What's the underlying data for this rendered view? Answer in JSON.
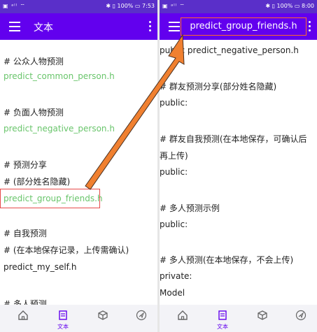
{
  "left": {
    "status_left": "▣ ᵃˡˡ ⌔",
    "status_right": "✱ ▯ 100% ▭ 7:53",
    "title": "文本",
    "lines": [
      "# 公众人物预测",
      "predict_common_person.h",
      "# 负面人物预测",
      "predict_negative_person.h",
      "# 预测分享",
      "#  (部分姓名隐藏)",
      "predict_group_friends.h",
      "# 自我预测",
      "#  (在本地保存记录，上传需确认)",
      "predict_my_self.h",
      "# 多人预测"
    ],
    "nav_label": "文本"
  },
  "right": {
    "status_left": "▣ ᵃˡˡ ⌔",
    "status_right": "✱ ▯ 100% ▭ 8:00",
    "title": "predict_group_friends.h",
    "lines": [
      "public predict_negative_person.h",
      "# 群友预测分享(部分姓名隐藏)",
      "public:",
      "# 群友自我预测(在本地保存，可确认后",
      "再上传)",
      "public:",
      "# 多人预测示例",
      "public:",
      "# 多人预测(在本地保存，不会上传)",
      "private:",
      "Model"
    ],
    "nav_label": "文本"
  },
  "colors": {
    "appbar": "#6200ee",
    "statusbar": "#5a2fc9",
    "code": "#69c56b",
    "arrow": "#f08030",
    "highlight": "#e64a4a",
    "title_highlight": "#ff6b2c"
  }
}
